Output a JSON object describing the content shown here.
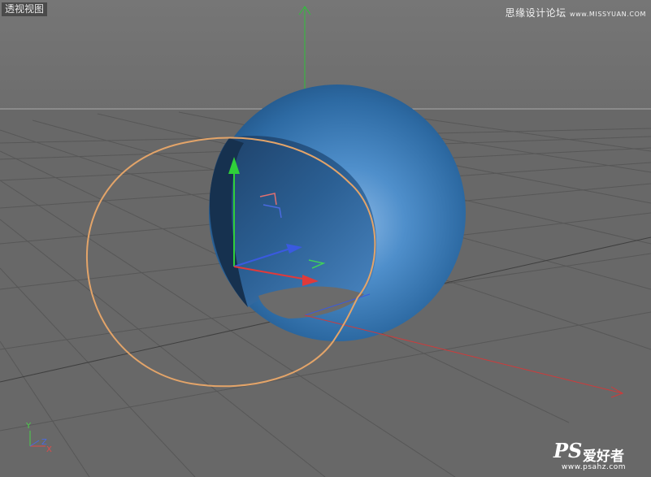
{
  "viewport": {
    "title": "透视视图"
  },
  "watermark_top": {
    "chinese": "思缘设计论坛",
    "site": "www.MISSYUAN.COM"
  },
  "watermark_bottom": {
    "logo": "PS",
    "chinese": "爱好者",
    "url": "www.psahz.com"
  },
  "axis_gizmo": {
    "y_label": "Y",
    "z_label": "Z",
    "x_label": "X"
  },
  "colors": {
    "background": "#6b6b6b",
    "grid_line": "#5a5a5a",
    "horizon": "#9a9a9a",
    "sphere": "#2f6fa8",
    "spline": "#e3a469",
    "axis_x": "#e03a3a",
    "axis_y": "#2fcf3a",
    "axis_z": "#3a5ae0"
  }
}
